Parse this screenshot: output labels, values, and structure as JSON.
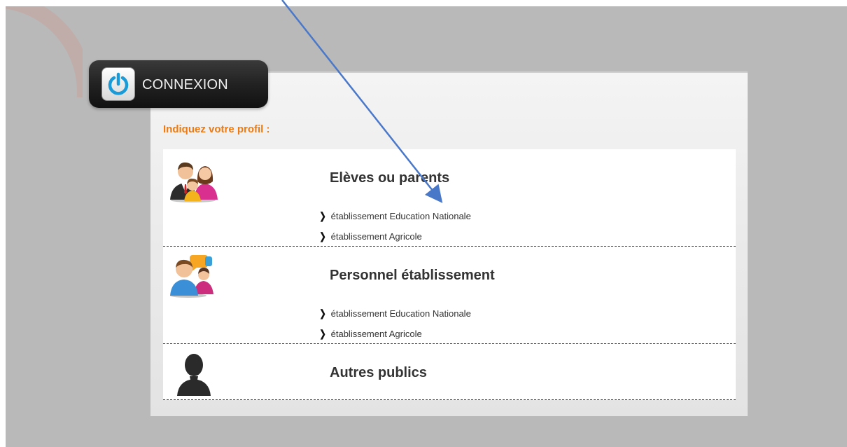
{
  "connexion": {
    "label": "CONNEXION",
    "icon": "power-icon"
  },
  "prompt": "Indiquez votre profil :",
  "colors": {
    "accent_orange": "#f07a10",
    "power_blue": "#1a9ad6",
    "arrow_blue": "#4a78c8"
  },
  "profiles": [
    {
      "title": "Elèves ou parents",
      "icon": "family-icon",
      "links": [
        "établissement Education Nationale",
        "établissement Agricole"
      ]
    },
    {
      "title": "Personnel établissement",
      "icon": "staff-icon",
      "links": [
        "établissement Education Nationale",
        "établissement Agricole"
      ]
    },
    {
      "title": "Autres publics",
      "icon": "person-silhouette-icon",
      "links": []
    }
  ]
}
